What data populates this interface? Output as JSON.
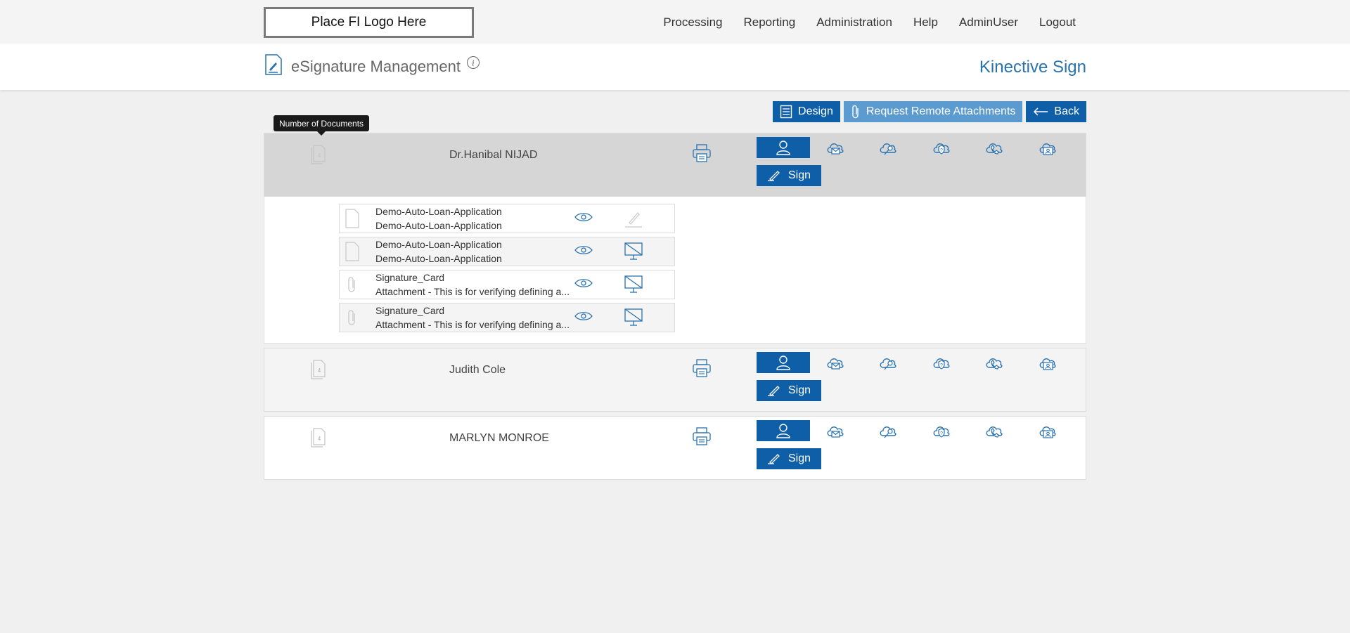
{
  "topbar": {
    "logo_text": "Place FI Logo Here",
    "nav": [
      "Processing",
      "Reporting",
      "Administration",
      "Help",
      "AdminUser",
      "Logout"
    ]
  },
  "header": {
    "title": "eSignature Management",
    "brand": "Kinective Sign"
  },
  "actions": {
    "design": "Design",
    "request_attachments": "Request Remote Attachments",
    "back": "Back"
  },
  "tooltip": "Number of Documents",
  "signers": [
    {
      "name": "Dr.Hanibal NIJAD",
      "doc_count": "4",
      "sign_label": "Sign"
    },
    {
      "name": "Judith Cole",
      "doc_count": "4",
      "sign_label": "Sign"
    },
    {
      "name": "MARLYN MONROE",
      "doc_count": "4",
      "sign_label": "Sign"
    }
  ],
  "documents": [
    {
      "line1": "Demo-Auto-Loan-Application",
      "line2": "Demo-Auto-Loan-Application",
      "kind": "document-icon",
      "action": "sign-pen-icon"
    },
    {
      "line1": "Demo-Auto-Loan-Application",
      "line2": "Demo-Auto-Loan-Application",
      "kind": "document-icon",
      "action": "no-display-icon"
    },
    {
      "line1": "Signature_Card",
      "line2": "Attachment - This is for verifying defining a...",
      "kind": "paperclip-icon",
      "action": "no-display-icon"
    },
    {
      "line1": "Signature_Card",
      "line2": "Attachment - This is for verifying defining a...",
      "kind": "paperclip-icon",
      "action": "no-display-icon"
    }
  ],
  "colors": {
    "primary": "#0f5ea8",
    "primary_light": "#5b9bd0",
    "brand_text": "#2a72ae",
    "expanded_row_bg": "#d6d6d6"
  }
}
